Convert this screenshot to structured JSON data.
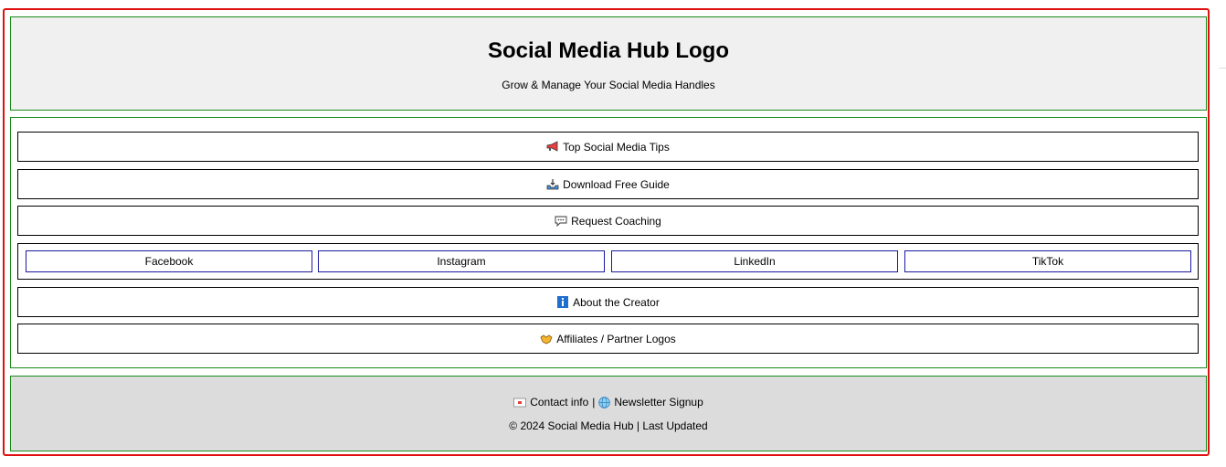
{
  "header": {
    "title": "Social Media Hub Logo",
    "tagline": "Grow & Manage Your Social Media Handles"
  },
  "nav": {
    "tips": {
      "label": "Top Social Media Tips",
      "icon": "megaphone-icon"
    },
    "guide": {
      "label": "Download Free Guide",
      "icon": "inbox-tray-icon"
    },
    "coaching": {
      "label": "Request Coaching",
      "icon": "speech-bubble-icon"
    },
    "about": {
      "label": "About the Creator",
      "icon": "info-icon"
    },
    "affiliates": {
      "label": "Affiliates / Partner Logos",
      "icon": "handshake-icon"
    }
  },
  "social": {
    "facebook": "Facebook",
    "instagram": "Instagram",
    "linkedin": "LinkedIn",
    "tiktok": "TikTok"
  },
  "footer": {
    "contact": "Contact info",
    "separator": "|",
    "newsletter": "Newsletter Signup",
    "copyright": "© 2024 Social Media Hub | Last Updated"
  },
  "colors": {
    "outer_border": "#e01010",
    "section_border": "#1a8a1a",
    "social_border": "#1a1aa0",
    "header_bg": "#f0f0f0",
    "footer_bg": "#dcdcdc"
  }
}
